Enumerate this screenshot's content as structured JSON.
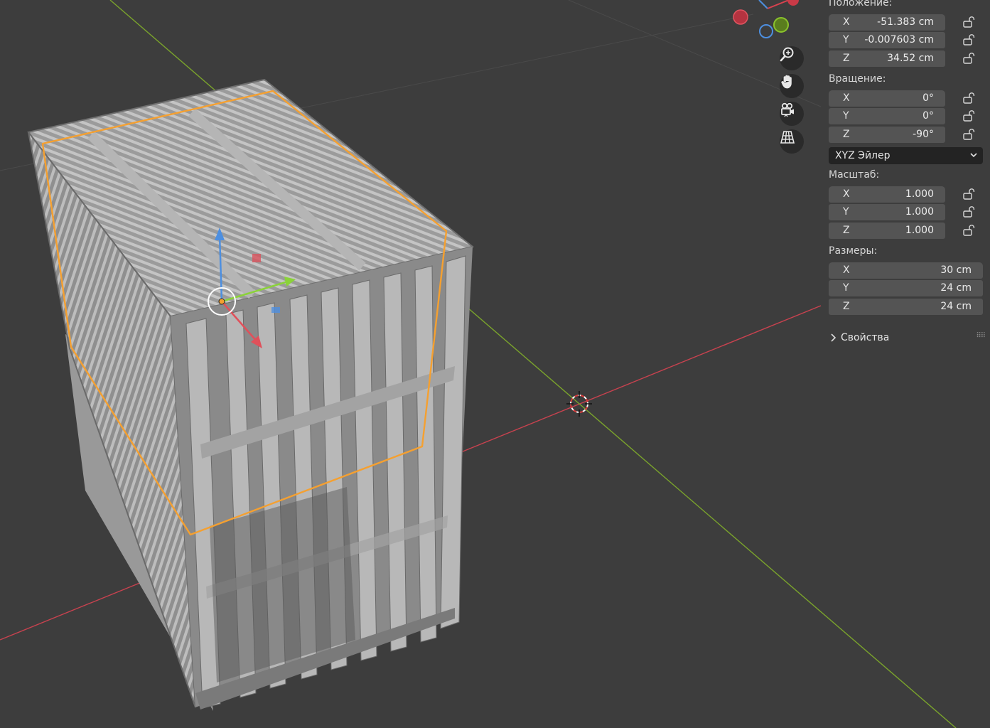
{
  "transform_panel": {
    "location": {
      "label": "Положение:",
      "x": {
        "axis": "X",
        "value": "-51.383 cm"
      },
      "y": {
        "axis": "Y",
        "value": "-0.007603 cm"
      },
      "z": {
        "axis": "Z",
        "value": "34.52 cm"
      }
    },
    "rotation": {
      "label": "Вращение:",
      "x": {
        "axis": "X",
        "value": "0°"
      },
      "y": {
        "axis": "Y",
        "value": "0°"
      },
      "z": {
        "axis": "Z",
        "value": "-90°"
      }
    },
    "rotation_mode": "XYZ Эйлер",
    "scale": {
      "label": "Масштаб:",
      "x": {
        "axis": "X",
        "value": "1.000"
      },
      "y": {
        "axis": "Y",
        "value": "1.000"
      },
      "z": {
        "axis": "Z",
        "value": "1.000"
      }
    },
    "dimensions": {
      "label": "Размеры:",
      "x": {
        "axis": "X",
        "value": "30 cm"
      },
      "y": {
        "axis": "Y",
        "value": "24 cm"
      },
      "z": {
        "axis": "Z",
        "value": "24 cm"
      }
    },
    "properties_label": "Свойства"
  },
  "viewport": {
    "nav_icons": [
      "zoom-icon",
      "hand-pan-icon",
      "camera-icon",
      "grid-ortho-icon"
    ],
    "colors": {
      "background": "#3d3d3d",
      "x_axis": "#c8424f",
      "y_axis": "#7aa32c",
      "selection_outline": "#f5a030",
      "model": "#a6a6a6"
    }
  }
}
